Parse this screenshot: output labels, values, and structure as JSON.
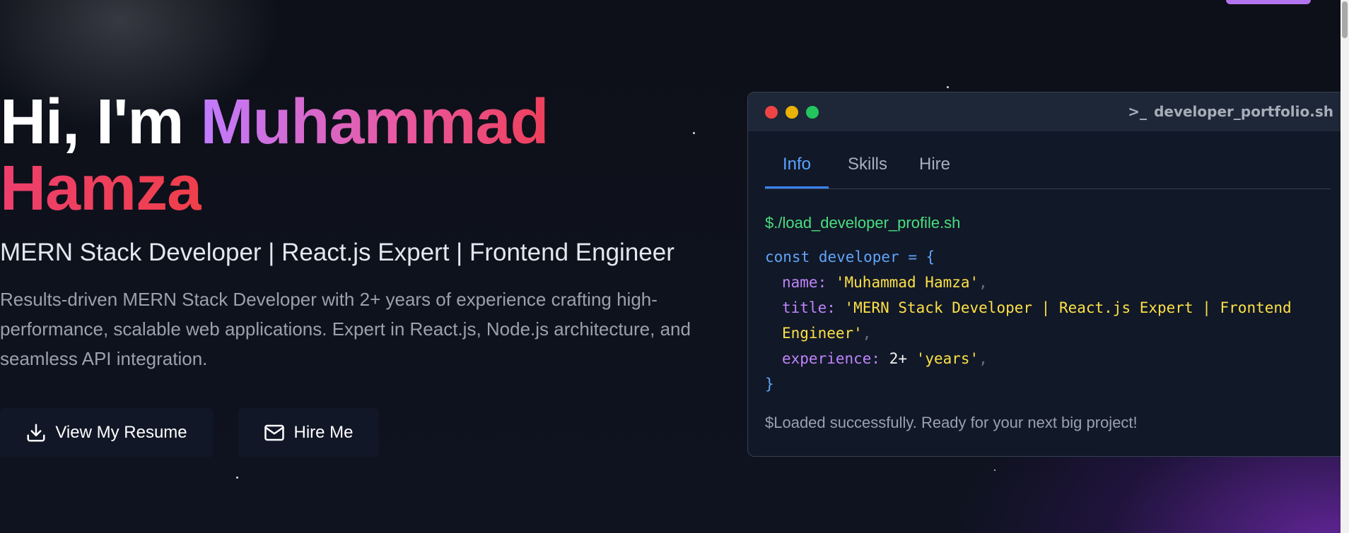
{
  "hero": {
    "greeting": "Hi, I'm",
    "first_name": "Muhammad",
    "last_name": "Hamza",
    "subtitle": "MERN Stack Developer | React.js Expert | Frontend Engineer",
    "description": "Results-driven MERN Stack Developer with 2+ years of experience crafting high-performance, scalable web applications. Expert in React.js, Node.js architecture, and seamless API integration.",
    "resume_label": "View My Resume",
    "hire_label": "Hire Me"
  },
  "terminal": {
    "title": "developer_portfolio.sh",
    "tabs": [
      "Info",
      "Skills",
      "Hire"
    ],
    "active_tab": "Info",
    "command": "$./load_developer_profile.sh",
    "code": {
      "decl_kw": "const",
      "decl_name": "developer",
      "decl_op": "= {",
      "name_key": "name:",
      "name_val": "'Muhammad Hamza'",
      "title_key": "title:",
      "title_val": "'MERN Stack Developer | React.js Expert | Frontend Engineer'",
      "exp_key": "experience:",
      "exp_num": "2+",
      "exp_val": "'years'",
      "comma": ",",
      "close": "}"
    },
    "status": "$Loaded successfully. Ready for your next big project!"
  },
  "icons": {
    "resume": "download-icon",
    "hire": "mail-icon"
  },
  "colors": {
    "accent_purple": "#b374f0",
    "name_gradient_start": "#c07cff",
    "name_gradient_end": "#ef3f5a",
    "command_green": "#4ade80",
    "tab_active_blue": "#3b82f6",
    "dot_red": "#ef4444",
    "dot_yellow": "#eab308",
    "dot_green": "#22c55e"
  }
}
